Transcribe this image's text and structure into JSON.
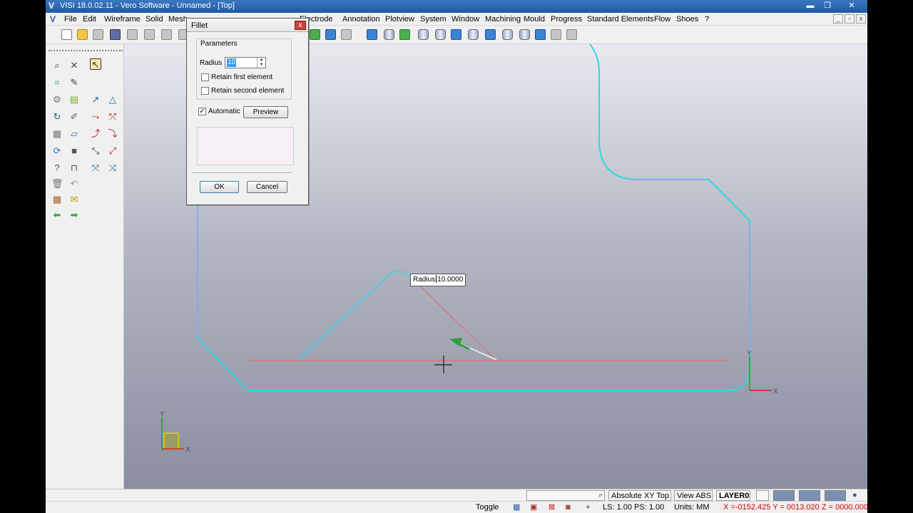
{
  "titlebar": {
    "title": "VISI 18.0.02.11 - Vero Software - Unnamed - [Top]",
    "minimize": "▬",
    "restore": "❐",
    "close": "✕"
  },
  "menubar": {
    "items": [
      "File",
      "Edit",
      "Wireframe",
      "Solid",
      "Mesh",
      "Electrode",
      "Annotation",
      "Plotview",
      "System",
      "Window",
      "Machining",
      "Mould",
      "Progress",
      "Standard Elements",
      "Flow",
      "Shoes",
      "?"
    ],
    "mdi_min": "_",
    "mdi_restore": "▫",
    "mdi_close": "x"
  },
  "dialog": {
    "title": "Fillet",
    "close": "x",
    "group_label": "Parameters",
    "radius_label": "Radius",
    "radius_value": "10",
    "retain_first_label": "Retain first element",
    "retain_first_checked": false,
    "retain_second_label": "Retain second element",
    "retain_second_checked": false,
    "automatic_label": "Automatic",
    "automatic_checked": true,
    "preview_label": "Preview",
    "ok_label": "OK",
    "cancel_label": "Cancel"
  },
  "canvas": {
    "radius_tip_label": "Radius",
    "radius_tip_value": "10.0000",
    "axis_x": "X",
    "axis_y": "Y",
    "profile_color": "#31d6e6",
    "construction_color": "#f06a6a"
  },
  "status1": {
    "view_name": "Absolute XY Top",
    "view_mode": "View ABS",
    "layer": "LAYER0"
  },
  "status2": {
    "toggle": "Toggle",
    "ls_ps": "LS: 1.00 PS: 1.00",
    "units": "Units: MM",
    "coords": "X =-0152.425 Y = 0013.020 Z = 0000.000"
  }
}
